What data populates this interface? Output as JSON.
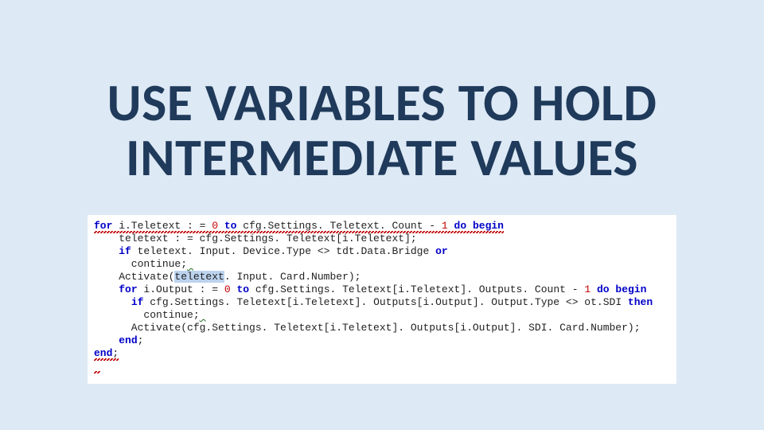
{
  "title": {
    "line1": "USE VARIABLES TO HOLD",
    "line2": "INTERMEDIATE VALUES"
  },
  "code": {
    "kw_for": "for",
    "kw_to": "to",
    "kw_do": "do",
    "kw_begin": "begin",
    "kw_if": "if",
    "kw_or": "or",
    "kw_then": "then",
    "kw_end": "end",
    "l1_var": " i.Teletext : = ",
    "l1_zero": "0",
    "l1_sp_to": " ",
    "l1_expr": " cfg.Settings. Teletext. Count - ",
    "l1_one": "1",
    "l1_sp_do": " ",
    "l2": "    teletext : = cfg.Settings. Teletext[i.Teletext];",
    "l3_a": "    ",
    "l3_b": " teletext. Input. Device.Type <> tdt.Data.Bridge ",
    "l4_a": "      continue;",
    "l4_wav": " ",
    "l5_a": "    Activate(",
    "l5_hl": "teletext",
    "l5_b": ". Input. Card.Number);",
    "l6_a": "    ",
    "l6_var": " i.Output : = ",
    "l6_zero": "0",
    "l6_sp_to": " ",
    "l6_expr": " cfg.Settings. Teletext[i.Teletext]. Outputs. Count - ",
    "l6_one": "1",
    "l6_sp_do": " ",
    "l7_a": "      ",
    "l7_b": " cfg.Settings. Teletext[i.Teletext]. Outputs[i.Output]. Output.Type <> ot.SDI ",
    "l8_a": "        continue;",
    "l8_wav": " ",
    "l9": "      Activate(cfg.Settings. Teletext[i.Teletext]. Outputs[i.Output]. SDI. Card.Number);",
    "l10_a": "    ",
    "l10_b": ";",
    "l11_a": "",
    "l11_b": ";",
    "l12": " "
  }
}
